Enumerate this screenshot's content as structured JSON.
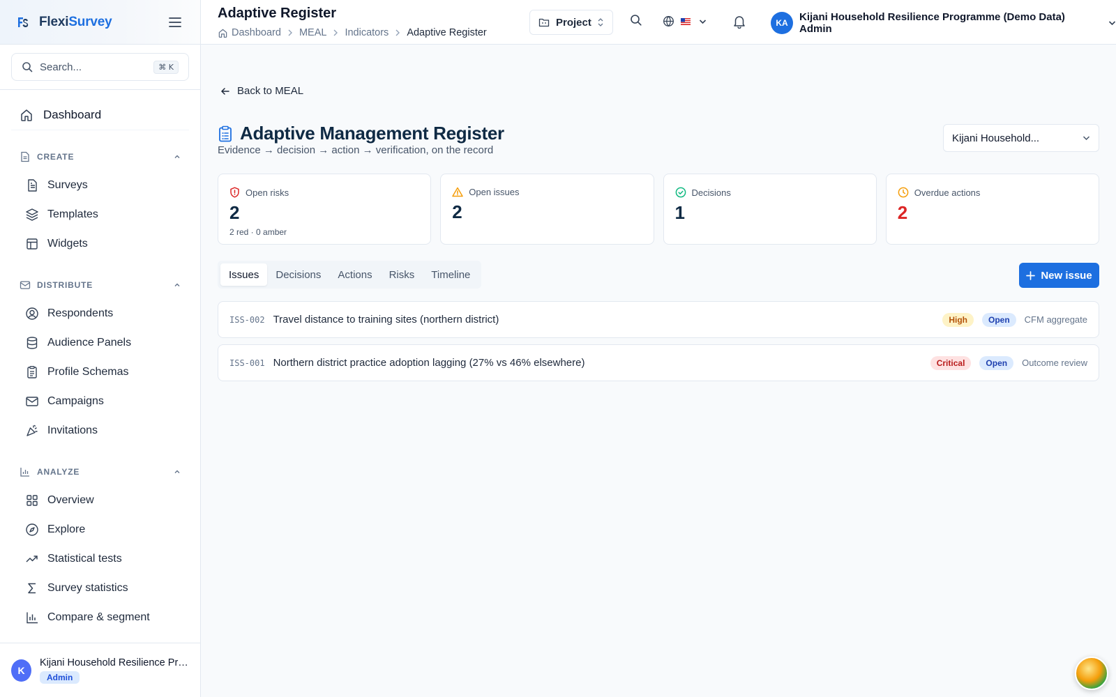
{
  "brand": {
    "name_part1": "Flexi",
    "name_part2": "Survey"
  },
  "search": {
    "placeholder": "Search...",
    "shortcut": "⌘ K"
  },
  "nav": {
    "dashboard": "Dashboard",
    "sections": [
      {
        "label": "CREATE",
        "items": [
          "Surveys",
          "Templates",
          "Widgets"
        ]
      },
      {
        "label": "DISTRIBUTE",
        "items": [
          "Respondents",
          "Audience Panels",
          "Profile Schemas",
          "Campaigns",
          "Invitations"
        ]
      },
      {
        "label": "ANALYZE",
        "items": [
          "Overview",
          "Explore",
          "Statistical tests",
          "Survey statistics",
          "Compare & segment"
        ]
      }
    ]
  },
  "footer": {
    "avatar": "K",
    "org": "Kijani Household Resilience Programme (Demo Data)",
    "role": "Admin"
  },
  "topbar": {
    "title": "Adaptive Register",
    "breadcrumb": [
      "Dashboard",
      "MEAL",
      "Indicators",
      "Adaptive Register"
    ],
    "project_label": "Project",
    "user_initials": "KA",
    "user_name": "Kijani Household Resilience Programme (Demo Data) Admin"
  },
  "main": {
    "back_label": "Back to MEAL",
    "title": "Adaptive Management Register",
    "subtitle": "Evidence → decision → action → verification, on the record",
    "project_select": "Kijani Household..."
  },
  "stats": [
    {
      "label": "Open risks",
      "value": "2",
      "sub": "2 red · 0 amber",
      "icon": "shield-alert-icon",
      "color": "#dc2626"
    },
    {
      "label": "Open issues",
      "value": "2",
      "sub": "",
      "icon": "warning-triangle-icon",
      "color": "#f59e0b"
    },
    {
      "label": "Decisions",
      "value": "1",
      "sub": "",
      "icon": "check-circle-icon",
      "color": "#10b981"
    },
    {
      "label": "Overdue actions",
      "value": "2",
      "sub": "",
      "icon": "clock-icon",
      "color": "#f59e0b"
    }
  ],
  "tabs": [
    "Issues",
    "Decisions",
    "Actions",
    "Risks",
    "Timeline"
  ],
  "new_issue_label": "New issue",
  "issues": [
    {
      "code": "ISS-002",
      "title": "Travel distance to training sites (northern district)",
      "severity": "High",
      "status": "Open",
      "source": "CFM aggregate"
    },
    {
      "code": "ISS-001",
      "title": "Northern district practice adoption lagging (27% vs 46% elsewhere)",
      "severity": "Critical",
      "status": "Open",
      "source": "Outcome review"
    }
  ]
}
